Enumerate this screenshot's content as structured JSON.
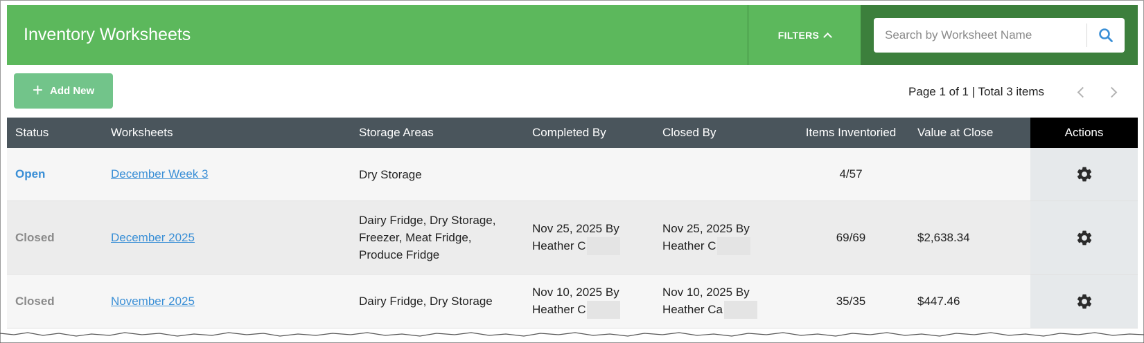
{
  "header": {
    "title": "Inventory Worksheets",
    "filters_label": "FILTERS",
    "search_placeholder": "Search by Worksheet Name"
  },
  "toolbar": {
    "add_label": "Add New",
    "pager_text": "Page 1 of 1 | Total 3 items"
  },
  "table": {
    "columns": [
      "Status",
      "Worksheets",
      "Storage Areas",
      "Completed By",
      "Closed By",
      "Items Inventoried",
      "Value at Close",
      "Actions"
    ],
    "rows": [
      {
        "status": "Open",
        "worksheet": "December Week 3",
        "storage_lines": [
          "Dry Storage"
        ],
        "completed_date": "",
        "completed_name": "",
        "closed_date": "",
        "closed_name": "",
        "items": "4/57",
        "value": ""
      },
      {
        "status": "Closed",
        "worksheet": "December 2025",
        "storage_lines": [
          "Dairy Fridge, Dry Storage,",
          "Freezer, Meat Fridge,",
          "Produce Fridge"
        ],
        "completed_date": "Nov 25, 2025 By",
        "completed_name": "Heather C",
        "closed_date": "Nov 25, 2025 By",
        "closed_name": "Heather C",
        "items": "69/69",
        "value": "$2,638.34"
      },
      {
        "status": "Closed",
        "worksheet": "November 2025",
        "storage_lines": [
          "Dairy Fridge, Dry Storage"
        ],
        "completed_date": "Nov 10, 2025 By",
        "completed_name": "Heather C",
        "closed_date": "Nov 10, 2025 By",
        "closed_name": "Heather Ca",
        "items": "35/35",
        "value": "$447.46"
      }
    ]
  },
  "icons": {
    "search": "search-icon",
    "filters": "chevron-up-icon",
    "add": "plus-icon",
    "prev": "chevron-left-icon",
    "next": "chevron-right-icon",
    "actions": "gear-icon"
  },
  "colors": {
    "header_green": "#5cb85c",
    "search_bg": "#3c7f3c",
    "add_button": "#72c48a",
    "table_header": "#4a555c",
    "link_blue": "#3a8fd6"
  }
}
